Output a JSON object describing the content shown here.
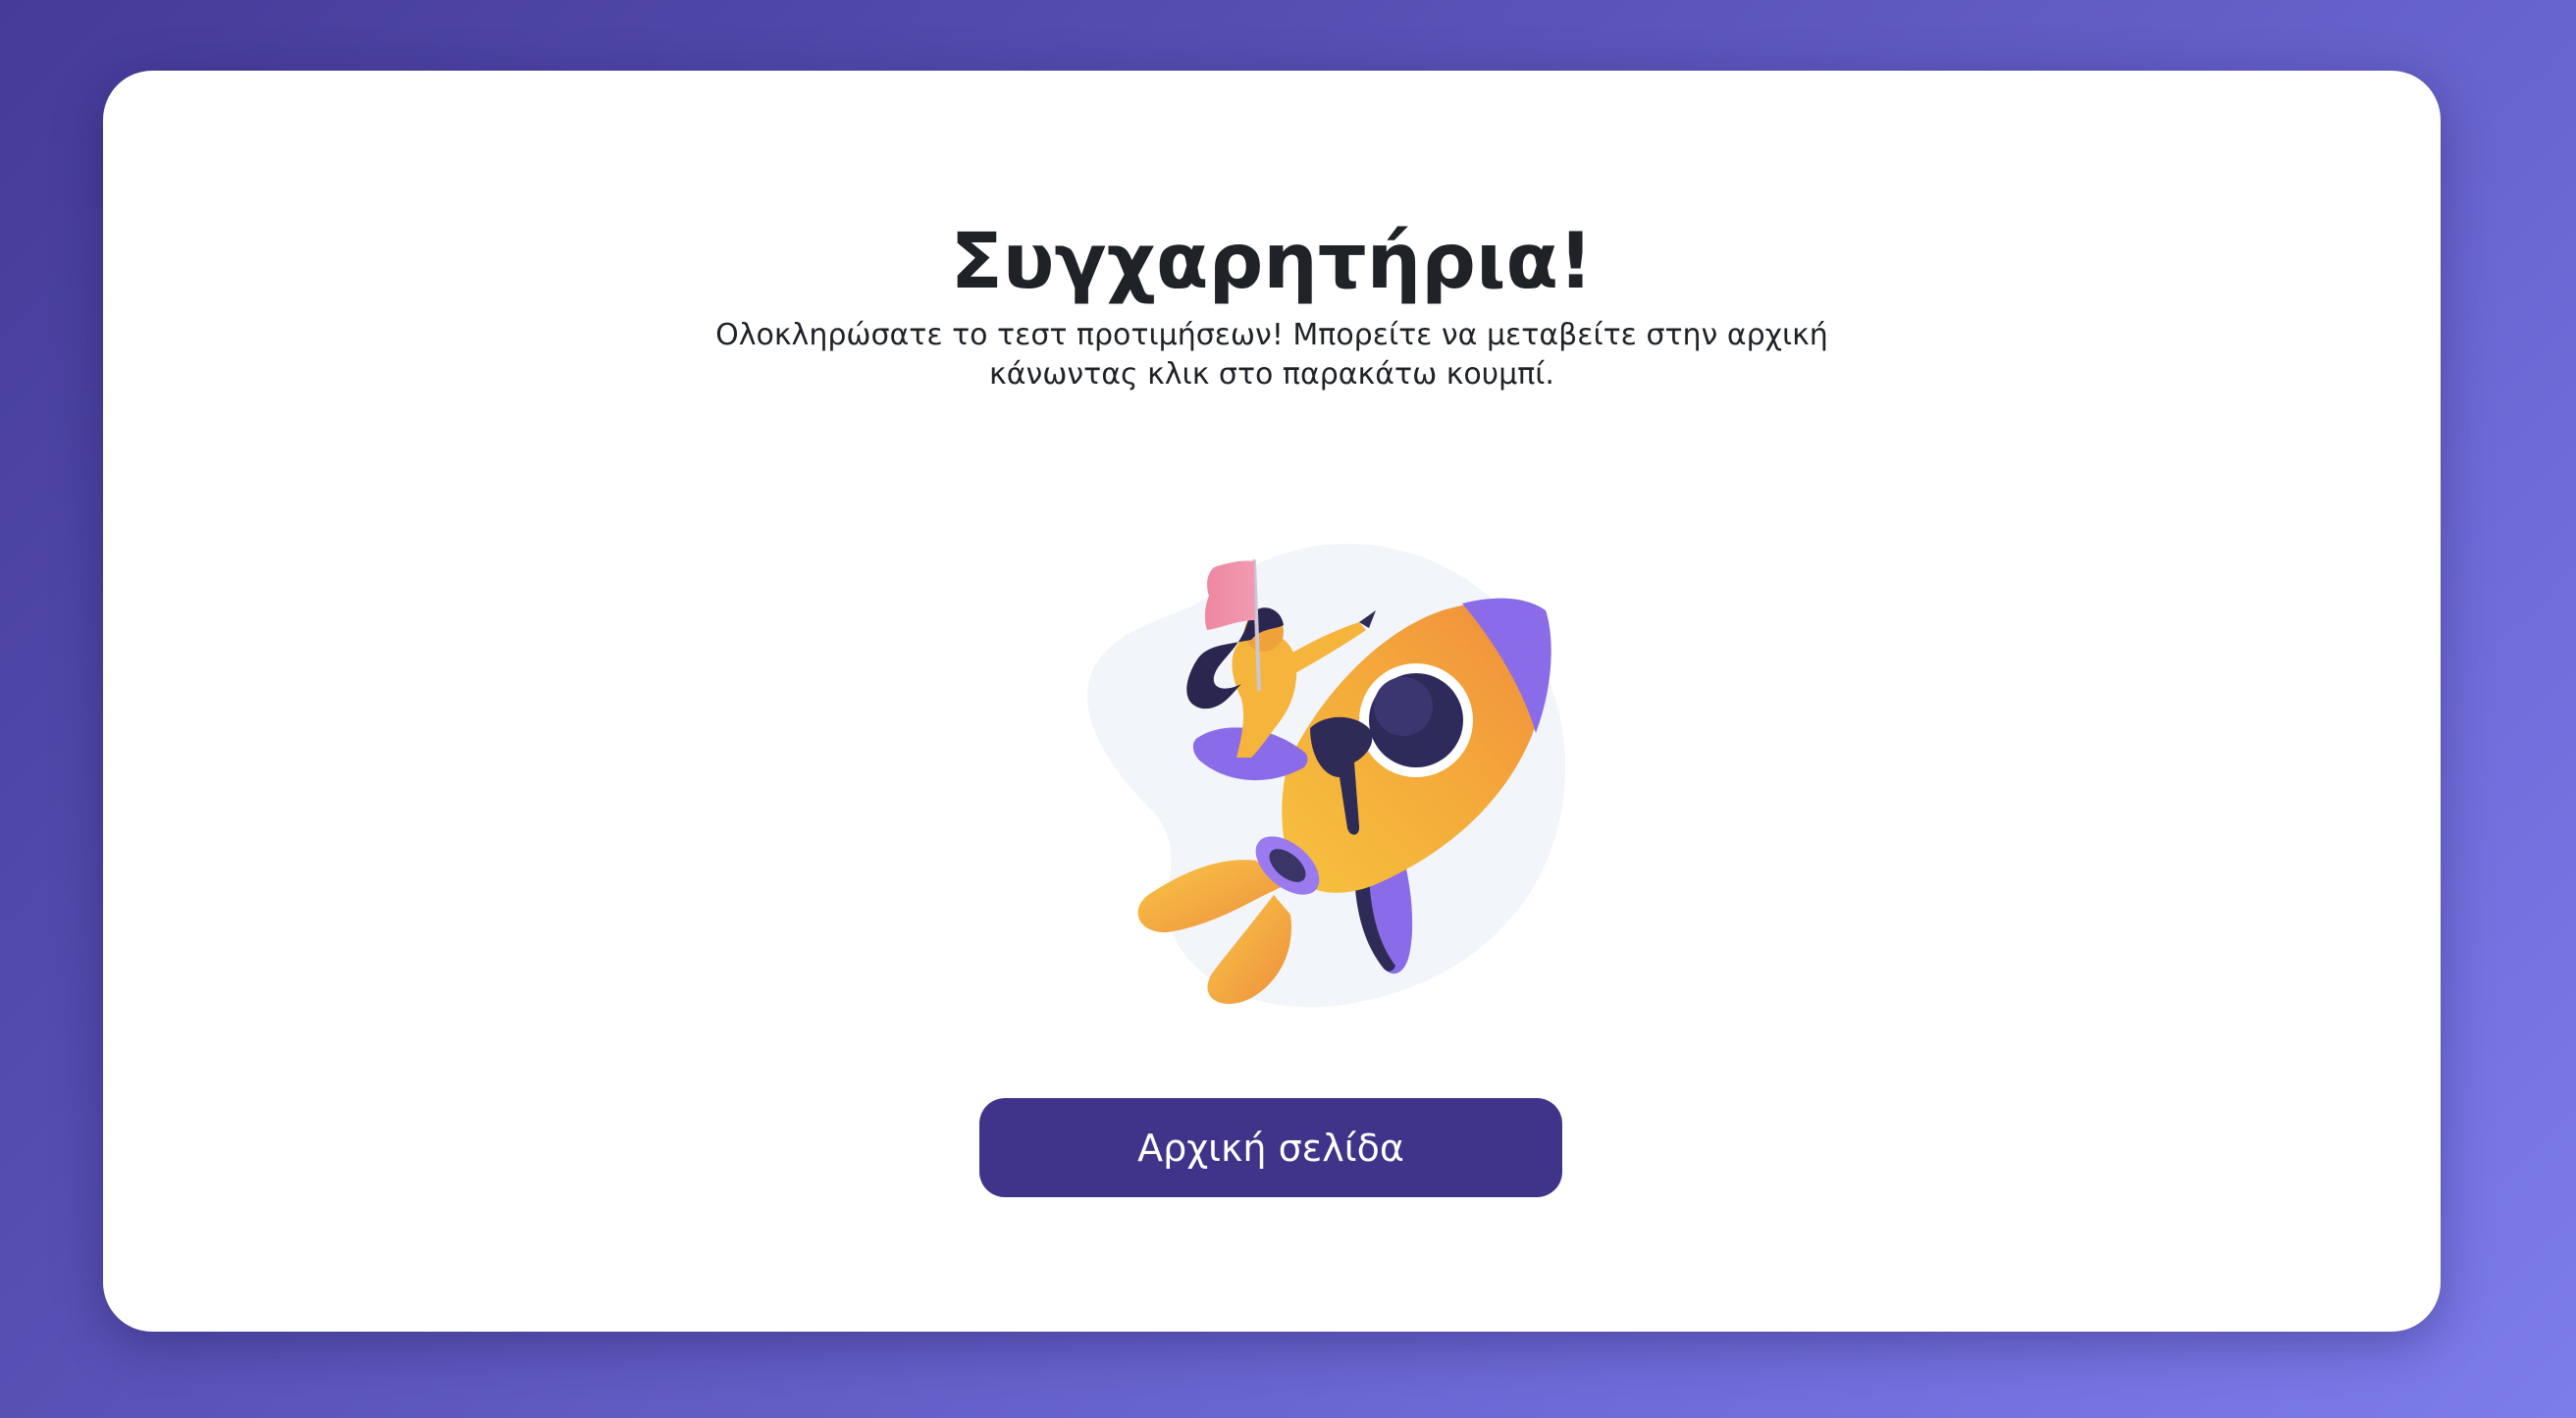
{
  "page": {
    "title": "Συγχαρητήρια!",
    "message": "Ολοκληρώσατε το τεστ προτιμήσεων! Μπορείτε να μεταβείτε στην αρχική κάνωντας κλικ στο παρακάτω κουμπί.",
    "home_button_label": "Αρχική σελίδα"
  },
  "illustration": {
    "icon": "rocket-launch-illustration"
  },
  "colors": {
    "background_start": "#453b98",
    "background_end": "#7d7ceb",
    "card": "#ffffff",
    "button": "#3f338a",
    "text": "#1f2227"
  }
}
